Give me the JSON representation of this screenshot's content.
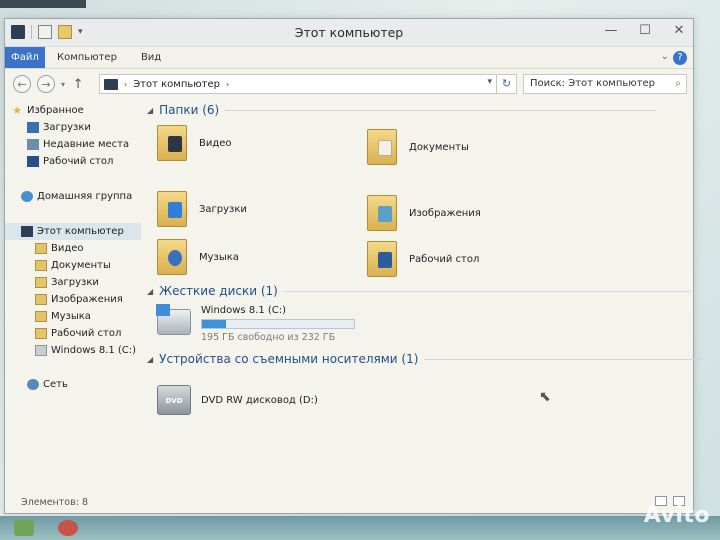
{
  "window": {
    "title": "Этот компьютер",
    "controls": {
      "minimize": "—",
      "maximize": "☐",
      "close": "✕"
    }
  },
  "ribbon": {
    "file_tab": "Файл",
    "tabs": [
      "Компьютер",
      "Вид"
    ],
    "expand_icon": "chevron-down-icon",
    "help": "?"
  },
  "navigation": {
    "back": "←",
    "forward": "→",
    "history": "▾",
    "up": "↑",
    "address_path": "Этот компьютер",
    "address_chevron": "›",
    "address_dropdown": "▾",
    "refresh": "↻",
    "search_placeholder": "Поиск: Этот компьютер",
    "search_icon": "⌕"
  },
  "sidebar": {
    "items": [
      {
        "label": "Избранное",
        "icon": "star-icon"
      },
      {
        "label": "Загрузки",
        "icon": "downloads-icon"
      },
      {
        "label": "Недавние места",
        "icon": "recent-icon"
      },
      {
        "label": "Рабочий стол",
        "icon": "desktop-icon"
      },
      {
        "label": "Домашняя группа",
        "icon": "homegroup-icon"
      },
      {
        "label": "Этот компьютер",
        "icon": "computer-icon",
        "selected": true
      },
      {
        "label": "Видео",
        "icon": "folder-icon"
      },
      {
        "label": "Документы",
        "icon": "folder-icon"
      },
      {
        "label": "Загрузки",
        "icon": "folder-icon"
      },
      {
        "label": "Изображения",
        "icon": "folder-icon"
      },
      {
        "label": "Музыка",
        "icon": "folder-icon"
      },
      {
        "label": "Рабочий стол",
        "icon": "folder-icon"
      },
      {
        "label": "Windows 8.1 (C:)",
        "icon": "drive-icon"
      },
      {
        "label": "Сеть",
        "icon": "network-icon"
      }
    ]
  },
  "content": {
    "groups": {
      "folders": "Папки (6)",
      "drives": "Жесткие диски (1)",
      "removable": "Устройства со съемными носителями (1)"
    },
    "folders": [
      {
        "label": "Видео",
        "icon": "video-folder-icon"
      },
      {
        "label": "Документы",
        "icon": "documents-folder-icon"
      },
      {
        "label": "Загрузки",
        "icon": "downloads-folder-icon"
      },
      {
        "label": "Изображения",
        "icon": "pictures-folder-icon"
      },
      {
        "label": "Музыка",
        "icon": "music-folder-icon"
      },
      {
        "label": "Рабочий стол",
        "icon": "desktop-folder-icon"
      }
    ],
    "drive": {
      "name": "Windows 8.1 (C:)",
      "free_text": "195 ГБ свободно из 232 ГБ",
      "used_fraction": 0.16
    },
    "dvd": {
      "name": "DVD RW дисковод (D:)",
      "icon_text": "DVD"
    }
  },
  "status": {
    "items_count": "Элементов: 8"
  },
  "watermark": "Avito",
  "colors": {
    "accent": "#3a73c7",
    "folder": "#e4c46a",
    "heading": "#1f4f8b",
    "usage_fill": "#3c93d8"
  }
}
